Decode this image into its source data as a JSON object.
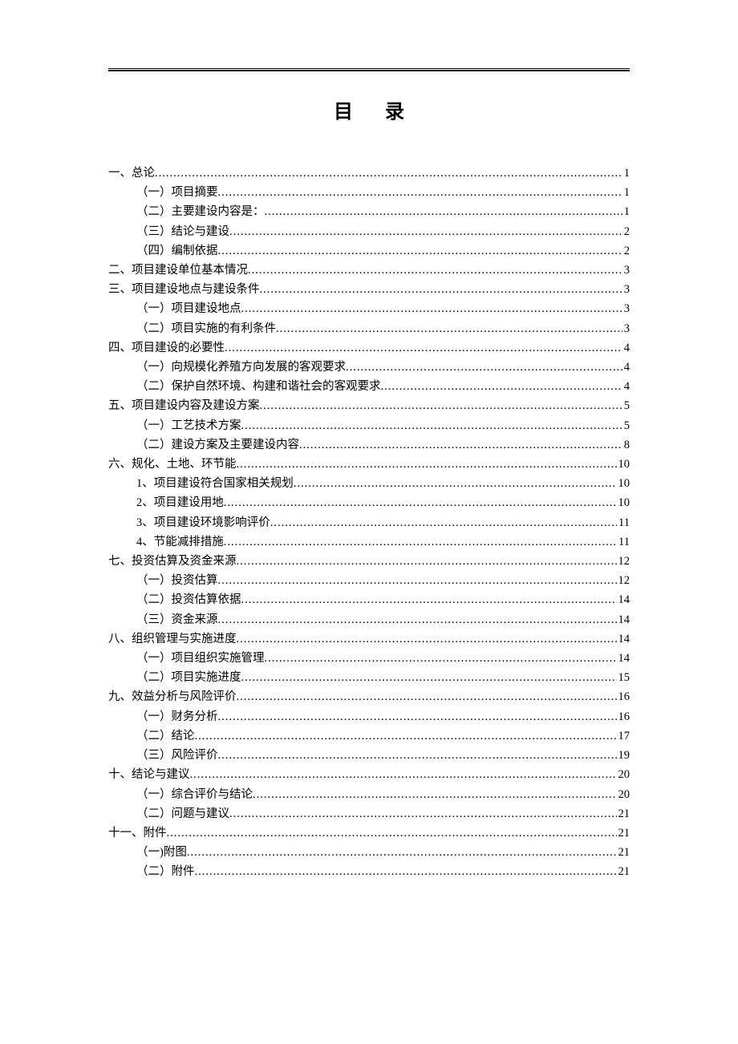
{
  "title": "目录",
  "toc": [
    {
      "level": 1,
      "label": "一、总论",
      "page": "1"
    },
    {
      "level": 2,
      "label": "（一）项目摘要",
      "page": "1"
    },
    {
      "level": 2,
      "label": "（二）主要建设内容是：",
      "page": "1"
    },
    {
      "level": 2,
      "label": "（三）结论与建设",
      "page": "2"
    },
    {
      "level": 2,
      "label": "（四）编制依据",
      "page": "2"
    },
    {
      "level": 1,
      "label": "二、项目建设单位基本情况",
      "page": "3"
    },
    {
      "level": 1,
      "label": "三、项目建设地点与建设条件",
      "page": "3"
    },
    {
      "level": 2,
      "label": "（一）项目建设地点",
      "page": "3"
    },
    {
      "level": 2,
      "label": "（二）项目实施的有利条件",
      "page": "3"
    },
    {
      "level": 1,
      "label": "四、项目建设的必要性",
      "page": "4"
    },
    {
      "level": 2,
      "label": "（一）向规模化养殖方向发展的客观要求",
      "page": "4"
    },
    {
      "level": 2,
      "label": "（二）保护自然环境、构建和谐社会的客观要求",
      "page": "4"
    },
    {
      "level": 1,
      "label": "五、项目建设内容及建设方案",
      "page": "5"
    },
    {
      "level": 2,
      "label": "（一）工艺技术方案",
      "page": "5"
    },
    {
      "level": 2,
      "label": "（二）建设方案及主要建设内容",
      "page": "8"
    },
    {
      "level": 1,
      "label": "六、规化、土地、环节能",
      "page": "10"
    },
    {
      "level": 2,
      "label": "1、项目建设符合国家相关规划",
      "page": "10"
    },
    {
      "level": 2,
      "label": "2、项目建设用地",
      "page": "10"
    },
    {
      "level": 2,
      "label": "3、项目建设环境影响评价",
      "page": "11"
    },
    {
      "level": 2,
      "label": "4、节能减排措施",
      "page": "11"
    },
    {
      "level": 1,
      "label": "七、投资估算及资金来源",
      "page": "12"
    },
    {
      "level": 2,
      "label": "（一）投资估算",
      "page": "12"
    },
    {
      "level": 2,
      "label": "（二）投资估算依据",
      "page": "14"
    },
    {
      "level": 2,
      "label": "（三）资金来源",
      "page": "14"
    },
    {
      "level": 1,
      "label": "八、组织管理与实施进度",
      "page": "14"
    },
    {
      "level": 2,
      "label": "（一）项目组织实施管理",
      "page": "14"
    },
    {
      "level": 2,
      "label": "（二）项目实施进度",
      "page": "15"
    },
    {
      "level": 1,
      "label": "九、效益分析与风险评价",
      "page": "16"
    },
    {
      "level": 2,
      "label": "（一）财务分析",
      "page": "16"
    },
    {
      "level": 2,
      "label": "（二）结论",
      "page": "17"
    },
    {
      "level": 2,
      "label": "（三）风险评价",
      "page": "19"
    },
    {
      "level": 1,
      "label": "十、结论与建议",
      "page": "20"
    },
    {
      "level": 2,
      "label": "（一）综合评价与结论",
      "page": "20"
    },
    {
      "level": 2,
      "label": "（二）问题与建议",
      "page": "21"
    },
    {
      "level": 1,
      "label": "十一、附件",
      "page": "21"
    },
    {
      "level": 2,
      "label": "（一)附图",
      "page": "21"
    },
    {
      "level": 2,
      "label": "（二）附件",
      "page": "21"
    }
  ]
}
